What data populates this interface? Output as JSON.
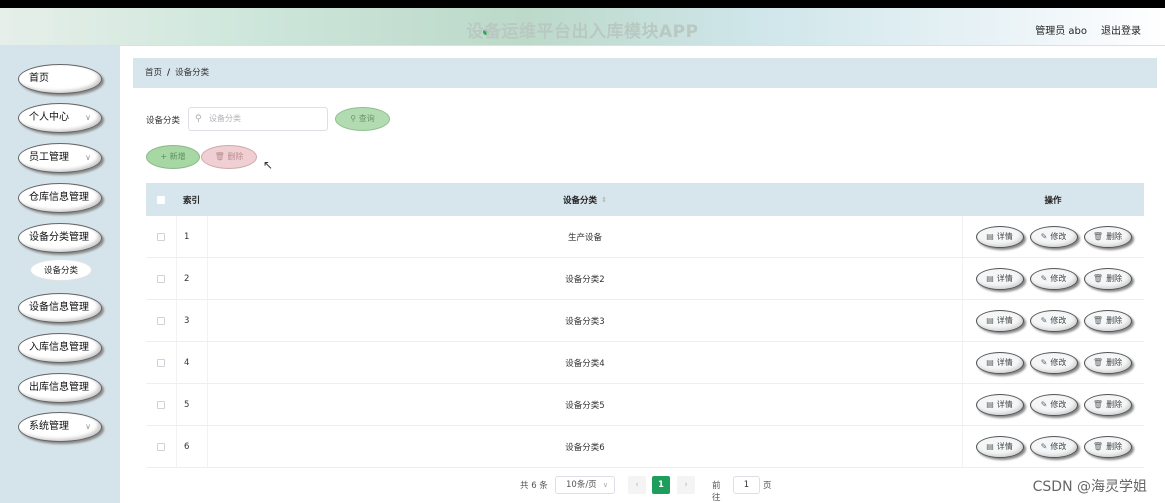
{
  "header": {
    "title": "设备运维平台出入库模块APP",
    "user_label": "管理员 abo",
    "logout_label": "退出登录"
  },
  "sidebar": {
    "items": [
      {
        "label": "首页",
        "has_chevron": false
      },
      {
        "label": "个人中心",
        "has_chevron": true
      },
      {
        "label": "员工管理",
        "has_chevron": true
      },
      {
        "label": "仓库信息管理",
        "has_chevron": false
      },
      {
        "label": "设备分类管理",
        "has_chevron": false
      },
      {
        "label": "设备信息管理",
        "has_chevron": false
      },
      {
        "label": "入库信息管理",
        "has_chevron": false
      },
      {
        "label": "出库信息管理",
        "has_chevron": false
      },
      {
        "label": "系统管理",
        "has_chevron": true
      }
    ],
    "sub_item": "设备分类"
  },
  "breadcrumb": {
    "home": "首页",
    "separator": "/",
    "current": "设备分类"
  },
  "search": {
    "label": "设备分类",
    "placeholder": "设备分类",
    "query_button": "查询"
  },
  "actions": {
    "add_button": "+ 新增",
    "delete_button": "删除"
  },
  "table": {
    "columns": {
      "index": "索引",
      "name": "设备分类",
      "ops": "操作"
    },
    "rows": [
      {
        "index": "1",
        "name": "生产设备"
      },
      {
        "index": "2",
        "name": "设备分类2"
      },
      {
        "index": "3",
        "name": "设备分类3"
      },
      {
        "index": "4",
        "name": "设备分类4"
      },
      {
        "index": "5",
        "name": "设备分类5"
      },
      {
        "index": "6",
        "name": "设备分类6"
      }
    ],
    "row_actions": {
      "detail": "详情",
      "edit": "修改",
      "delete": "删除"
    }
  },
  "pagination": {
    "total": "共 6 条",
    "page_size": "10条/页",
    "current_page": "1",
    "goto_label": "前往",
    "goto_value": "1",
    "unit": "页"
  },
  "watermark": "CSDN @海灵学姐",
  "colors": {
    "accent_green": "#1e9e5a",
    "sidebar_bg": "#d5e4ea",
    "table_header_bg": "#d7e5ec"
  }
}
